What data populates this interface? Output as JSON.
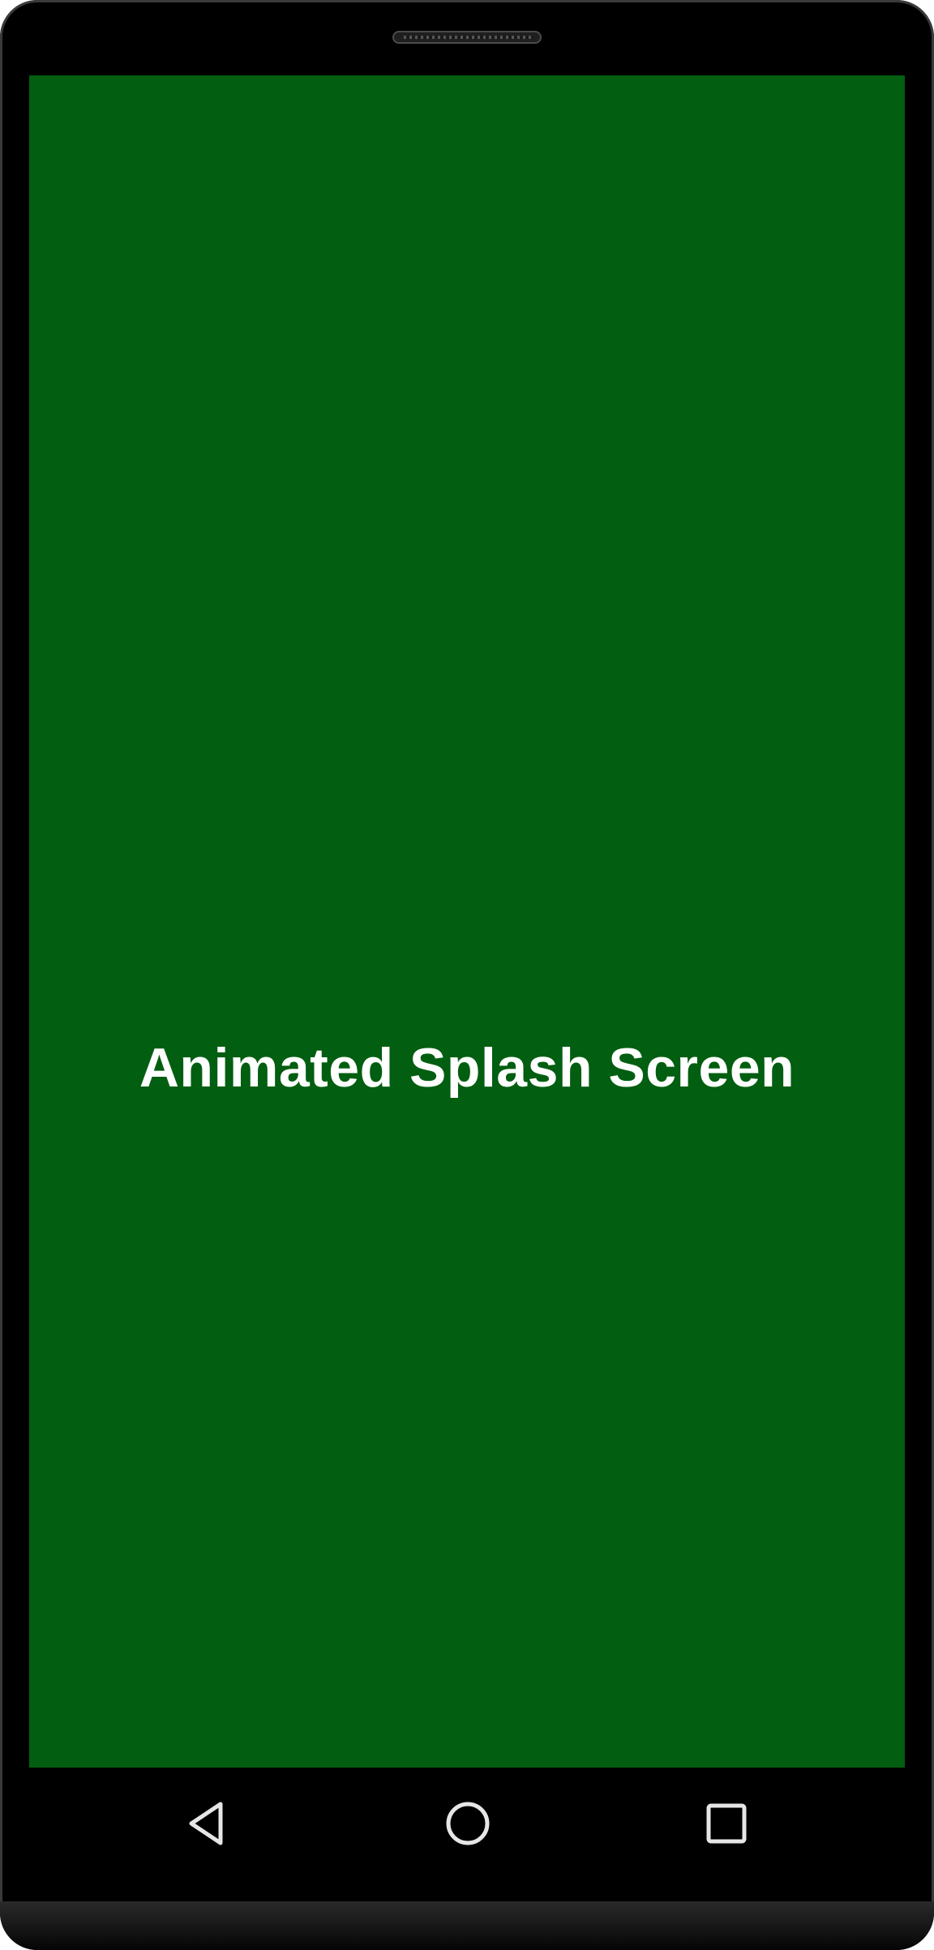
{
  "app": {
    "splash_title": "Animated Splash Screen"
  },
  "colors": {
    "screen_background": "#025e10",
    "title_text": "#ffffff",
    "device_frame": "#000000",
    "nav_icon": "#e6e6e6"
  },
  "navigation_bar": {
    "icons": [
      "back-icon",
      "home-icon",
      "recents-icon"
    ]
  }
}
